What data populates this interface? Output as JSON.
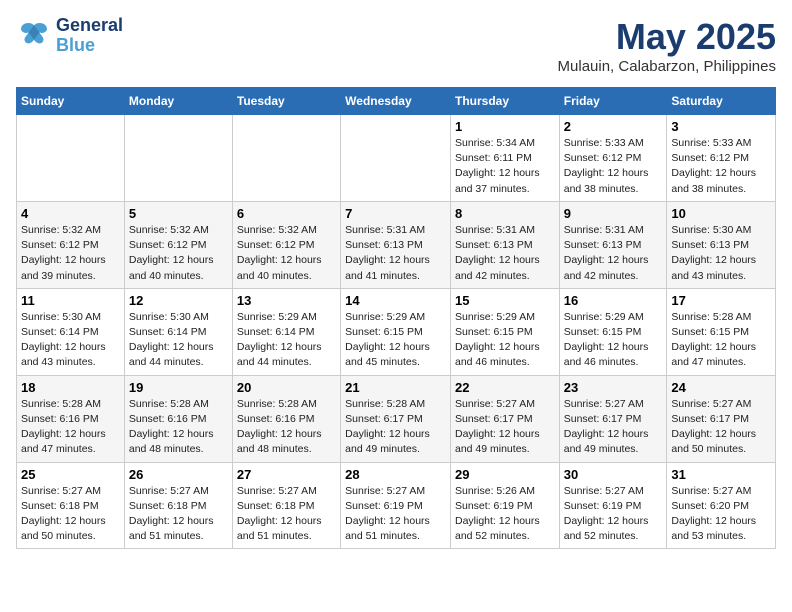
{
  "header": {
    "logo_general": "General",
    "logo_blue": "Blue",
    "month": "May 2025",
    "location": "Mulauin, Calabarzon, Philippines"
  },
  "days_of_week": [
    "Sunday",
    "Monday",
    "Tuesday",
    "Wednesday",
    "Thursday",
    "Friday",
    "Saturday"
  ],
  "weeks": [
    [
      {
        "day": "",
        "info": ""
      },
      {
        "day": "",
        "info": ""
      },
      {
        "day": "",
        "info": ""
      },
      {
        "day": "",
        "info": ""
      },
      {
        "day": "1",
        "info": "Sunrise: 5:34 AM\nSunset: 6:11 PM\nDaylight: 12 hours\nand 37 minutes."
      },
      {
        "day": "2",
        "info": "Sunrise: 5:33 AM\nSunset: 6:12 PM\nDaylight: 12 hours\nand 38 minutes."
      },
      {
        "day": "3",
        "info": "Sunrise: 5:33 AM\nSunset: 6:12 PM\nDaylight: 12 hours\nand 38 minutes."
      }
    ],
    [
      {
        "day": "4",
        "info": "Sunrise: 5:32 AM\nSunset: 6:12 PM\nDaylight: 12 hours\nand 39 minutes."
      },
      {
        "day": "5",
        "info": "Sunrise: 5:32 AM\nSunset: 6:12 PM\nDaylight: 12 hours\nand 40 minutes."
      },
      {
        "day": "6",
        "info": "Sunrise: 5:32 AM\nSunset: 6:12 PM\nDaylight: 12 hours\nand 40 minutes."
      },
      {
        "day": "7",
        "info": "Sunrise: 5:31 AM\nSunset: 6:13 PM\nDaylight: 12 hours\nand 41 minutes."
      },
      {
        "day": "8",
        "info": "Sunrise: 5:31 AM\nSunset: 6:13 PM\nDaylight: 12 hours\nand 42 minutes."
      },
      {
        "day": "9",
        "info": "Sunrise: 5:31 AM\nSunset: 6:13 PM\nDaylight: 12 hours\nand 42 minutes."
      },
      {
        "day": "10",
        "info": "Sunrise: 5:30 AM\nSunset: 6:13 PM\nDaylight: 12 hours\nand 43 minutes."
      }
    ],
    [
      {
        "day": "11",
        "info": "Sunrise: 5:30 AM\nSunset: 6:14 PM\nDaylight: 12 hours\nand 43 minutes."
      },
      {
        "day": "12",
        "info": "Sunrise: 5:30 AM\nSunset: 6:14 PM\nDaylight: 12 hours\nand 44 minutes."
      },
      {
        "day": "13",
        "info": "Sunrise: 5:29 AM\nSunset: 6:14 PM\nDaylight: 12 hours\nand 44 minutes."
      },
      {
        "day": "14",
        "info": "Sunrise: 5:29 AM\nSunset: 6:15 PM\nDaylight: 12 hours\nand 45 minutes."
      },
      {
        "day": "15",
        "info": "Sunrise: 5:29 AM\nSunset: 6:15 PM\nDaylight: 12 hours\nand 46 minutes."
      },
      {
        "day": "16",
        "info": "Sunrise: 5:29 AM\nSunset: 6:15 PM\nDaylight: 12 hours\nand 46 minutes."
      },
      {
        "day": "17",
        "info": "Sunrise: 5:28 AM\nSunset: 6:15 PM\nDaylight: 12 hours\nand 47 minutes."
      }
    ],
    [
      {
        "day": "18",
        "info": "Sunrise: 5:28 AM\nSunset: 6:16 PM\nDaylight: 12 hours\nand 47 minutes."
      },
      {
        "day": "19",
        "info": "Sunrise: 5:28 AM\nSunset: 6:16 PM\nDaylight: 12 hours\nand 48 minutes."
      },
      {
        "day": "20",
        "info": "Sunrise: 5:28 AM\nSunset: 6:16 PM\nDaylight: 12 hours\nand 48 minutes."
      },
      {
        "day": "21",
        "info": "Sunrise: 5:28 AM\nSunset: 6:17 PM\nDaylight: 12 hours\nand 49 minutes."
      },
      {
        "day": "22",
        "info": "Sunrise: 5:27 AM\nSunset: 6:17 PM\nDaylight: 12 hours\nand 49 minutes."
      },
      {
        "day": "23",
        "info": "Sunrise: 5:27 AM\nSunset: 6:17 PM\nDaylight: 12 hours\nand 49 minutes."
      },
      {
        "day": "24",
        "info": "Sunrise: 5:27 AM\nSunset: 6:17 PM\nDaylight: 12 hours\nand 50 minutes."
      }
    ],
    [
      {
        "day": "25",
        "info": "Sunrise: 5:27 AM\nSunset: 6:18 PM\nDaylight: 12 hours\nand 50 minutes."
      },
      {
        "day": "26",
        "info": "Sunrise: 5:27 AM\nSunset: 6:18 PM\nDaylight: 12 hours\nand 51 minutes."
      },
      {
        "day": "27",
        "info": "Sunrise: 5:27 AM\nSunset: 6:18 PM\nDaylight: 12 hours\nand 51 minutes."
      },
      {
        "day": "28",
        "info": "Sunrise: 5:27 AM\nSunset: 6:19 PM\nDaylight: 12 hours\nand 51 minutes."
      },
      {
        "day": "29",
        "info": "Sunrise: 5:26 AM\nSunset: 6:19 PM\nDaylight: 12 hours\nand 52 minutes."
      },
      {
        "day": "30",
        "info": "Sunrise: 5:27 AM\nSunset: 6:19 PM\nDaylight: 12 hours\nand 52 minutes."
      },
      {
        "day": "31",
        "info": "Sunrise: 5:27 AM\nSunset: 6:20 PM\nDaylight: 12 hours\nand 53 minutes."
      }
    ]
  ]
}
